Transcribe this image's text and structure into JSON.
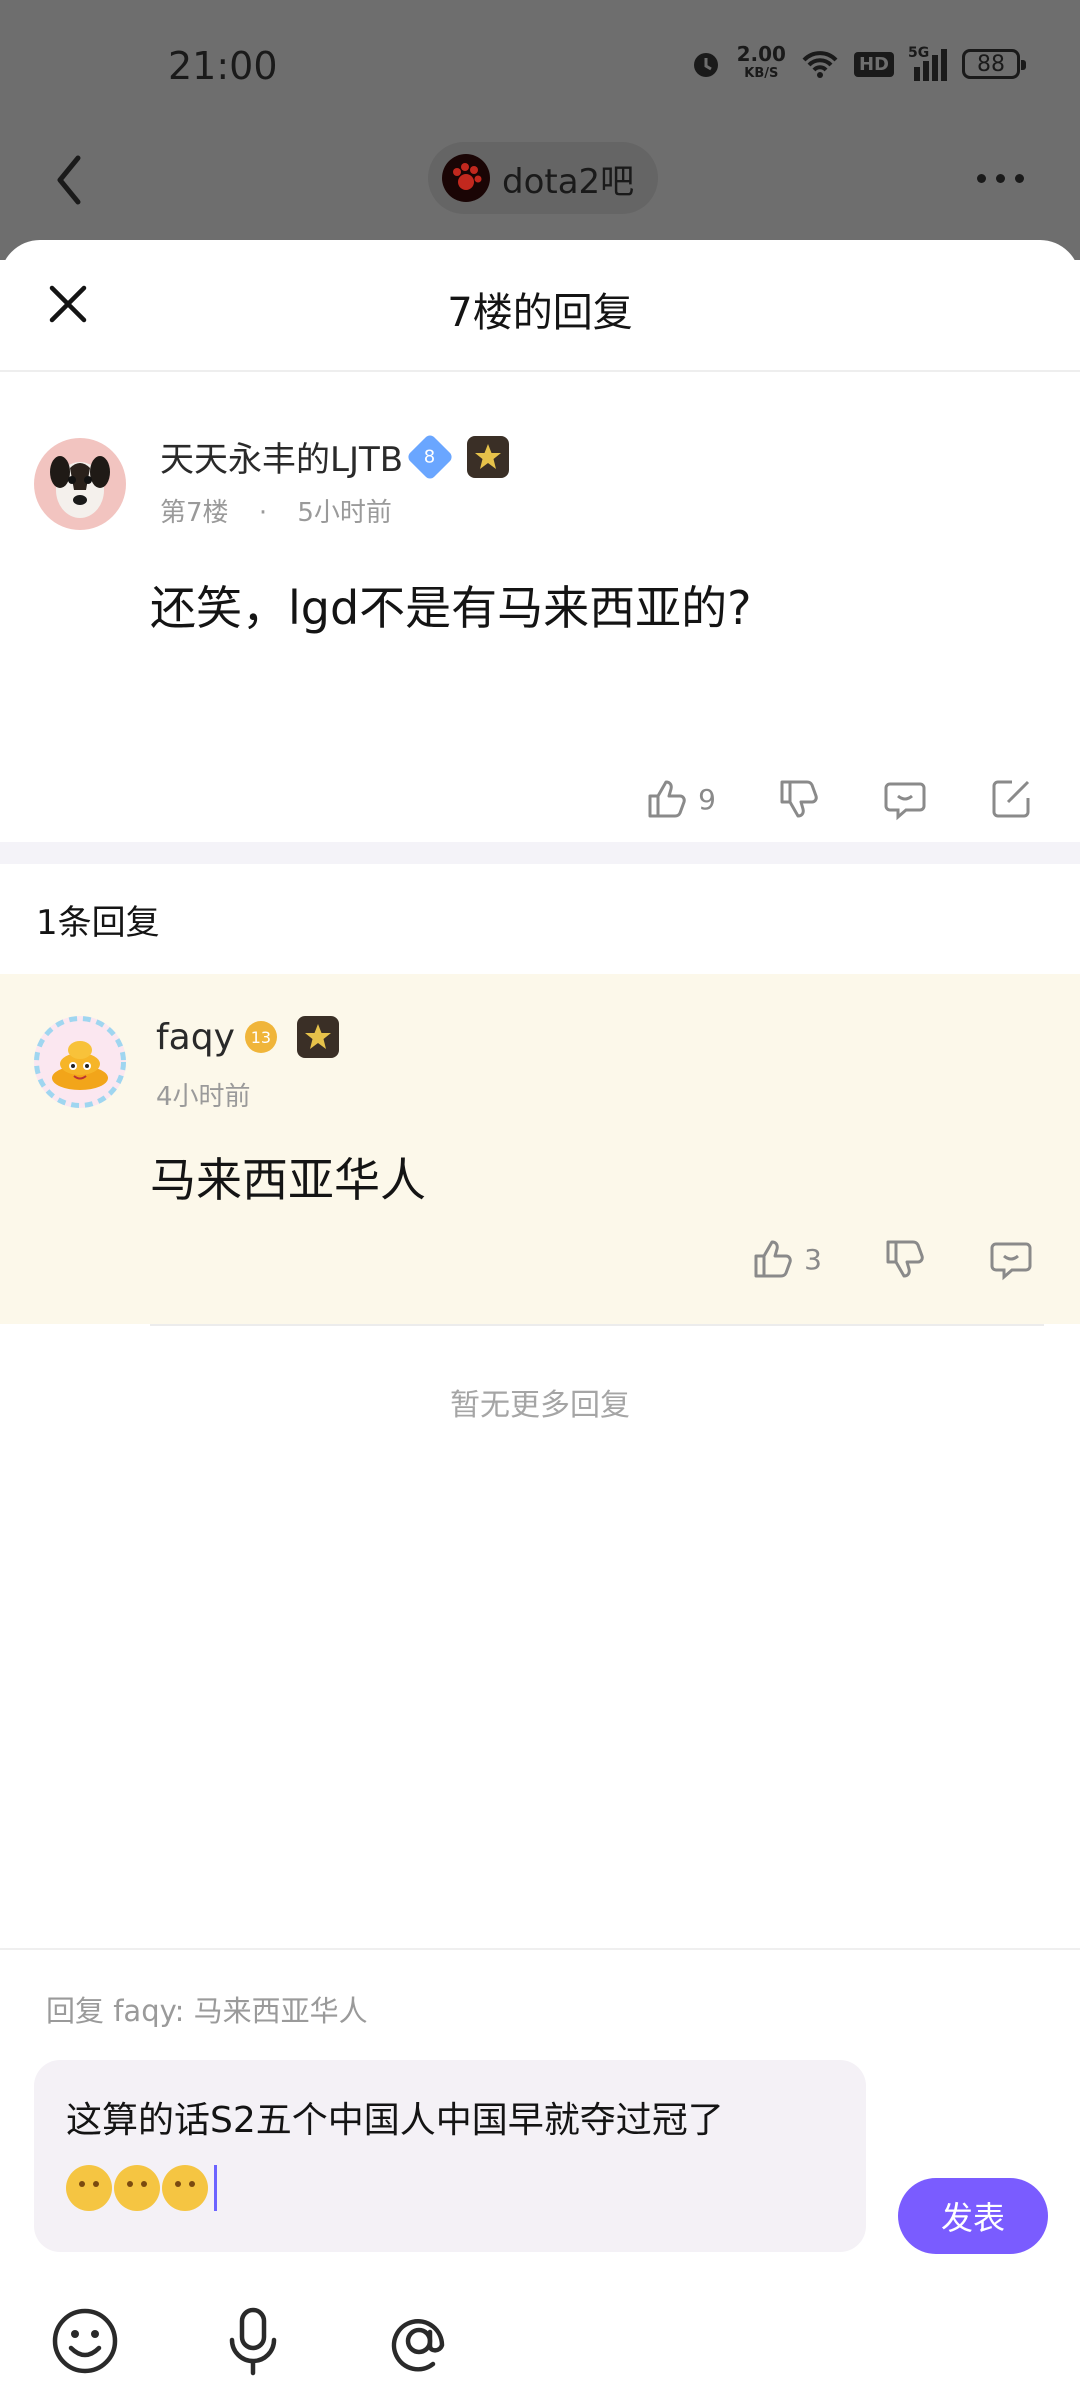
{
  "status_bar": {
    "time": "21:00",
    "net_speed": "2.00",
    "net_unit": "KB/S",
    "hd": "HD",
    "signal": "5G",
    "battery": "88"
  },
  "top_nav": {
    "forum_name": "dota2吧"
  },
  "sheet": {
    "title": "7楼的回复"
  },
  "post": {
    "author": "天天永丰的LJTB",
    "level": "8",
    "floor": "第7楼",
    "dot": "·",
    "time": "5小时前",
    "content": "还笑，lgd不是有马来西亚的?",
    "likes": "9"
  },
  "reply_count": "1条回复",
  "replies": [
    {
      "author": "faqy",
      "level": "13",
      "time": "4小时前",
      "content": "马来西亚华人",
      "likes": "3"
    }
  ],
  "no_more": "暂无更多回复",
  "composer": {
    "reply_to": "回复 faqy: 马来西亚华人",
    "input_text": "这算的话S2五个中国人中国早就夺过冠了",
    "emoji_count": 3,
    "send_label": "发表"
  },
  "icons": {
    "back": "back-arrow-icon",
    "more": "more-dots-icon",
    "close": "close-icon",
    "like": "thumbs-up-icon",
    "dislike": "thumbs-down-icon",
    "comment": "comment-icon",
    "share": "share-icon",
    "emoji": "emoji-icon",
    "mic": "microphone-icon",
    "mention": "at-mention-icon"
  },
  "colors": {
    "accent": "#7a5cff",
    "reply_highlight": "#fcf8ea",
    "backdrop": "#6e6e6e"
  }
}
